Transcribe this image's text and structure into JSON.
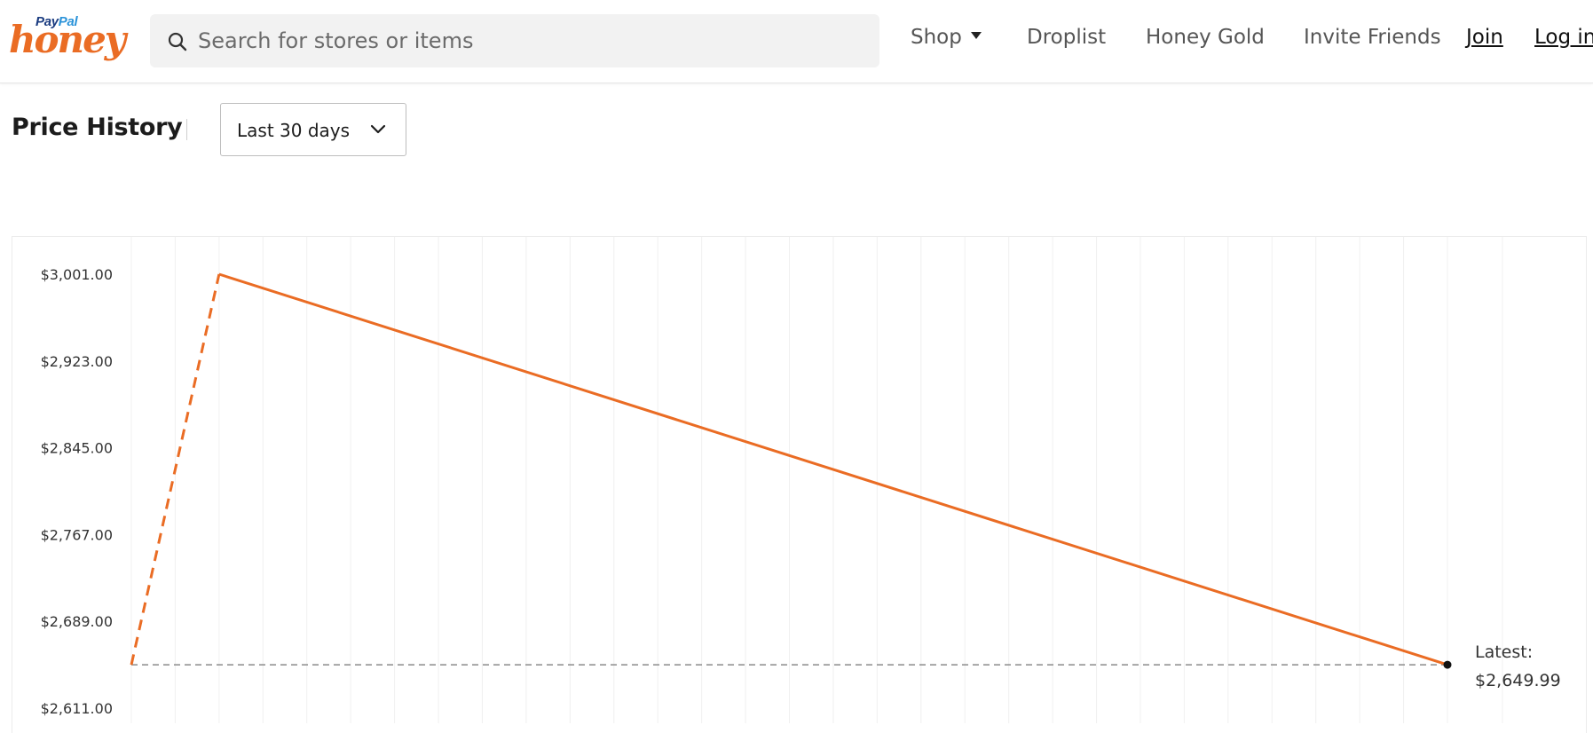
{
  "brand": {
    "paypal_pay": "Pay",
    "paypal_pal": "Pal",
    "honey": "honey",
    "colors": {
      "accent": "#ea6c24",
      "paypal_dark": "#1b3c80",
      "paypal_light": "#2b93d9"
    }
  },
  "search": {
    "placeholder": "Search for stores or items",
    "icon": "search-icon"
  },
  "nav": {
    "shop": "Shop",
    "droplist": "Droplist",
    "honey_gold": "Honey Gold",
    "invite_friends": "Invite Friends",
    "join": "Join",
    "login": "Log in"
  },
  "price_history": {
    "title": "Price History",
    "range_selected": "Last 30 days",
    "range_icon": "chevron-down-icon"
  },
  "chart_data": {
    "type": "line",
    "title": "",
    "xlabel": "",
    "ylabel": "",
    "ylim": [
      2611.0,
      3001.0
    ],
    "yticks": [
      3001.0,
      2923.0,
      2845.0,
      2767.0,
      2689.0,
      2611.0
    ],
    "ytick_labels": [
      "$3,001.00",
      "$2,923.00",
      "$2,845.00",
      "$2,767.00",
      "$2,689.00",
      "$2,611.00"
    ],
    "x_range_days": [
      0,
      30
    ],
    "series": [
      {
        "style": "dashed",
        "color": "#ea6c24",
        "points": [
          {
            "x": 0,
            "y": 2649.99
          },
          {
            "x": 2,
            "y": 3001.0
          }
        ]
      },
      {
        "style": "solid",
        "color": "#ea6c24",
        "points": [
          {
            "x": 2,
            "y": 3001.0
          },
          {
            "x": 30,
            "y": 2649.99
          }
        ]
      }
    ],
    "reference_line": {
      "y": 2649.99,
      "style": "dashed",
      "color": "#8a8a8a"
    },
    "latest": {
      "label": "Latest:",
      "value_text": "$2,649.99",
      "value": 2649.99
    },
    "grid": {
      "vertical": true,
      "count": 30
    }
  }
}
